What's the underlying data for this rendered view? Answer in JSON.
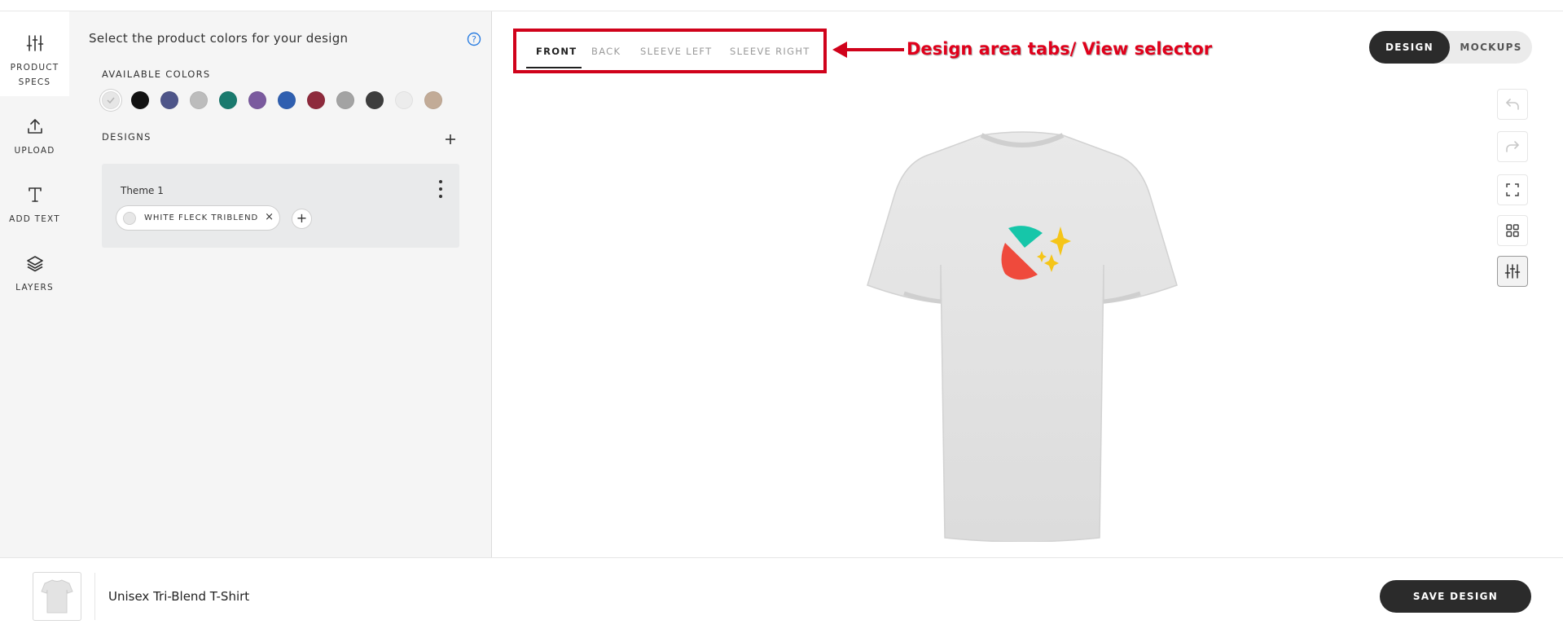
{
  "rail": {
    "items": [
      {
        "label_line1": "PRODUCT",
        "label_line2": "SPECS",
        "icon": "sliders-icon"
      },
      {
        "label": "UPLOAD",
        "icon": "upload-icon"
      },
      {
        "label": "ADD TEXT",
        "icon": "text-icon"
      },
      {
        "label": "LAYERS",
        "icon": "layers-icon"
      }
    ]
  },
  "panel": {
    "title": "Select the product colors for your design",
    "help_icon": "question-circle-icon",
    "available_colors_label": "AVAILABLE COLORS",
    "colors": [
      "#e6e6e6",
      "#111111",
      "#4e5589",
      "#bcbcbc",
      "#1a7a6e",
      "#7a5a9e",
      "#2f5fb0",
      "#8e2a3c",
      "#a3a3a3",
      "#3d3d3d",
      "#ececec",
      "#c2ab97"
    ],
    "designs_label": "DESIGNS",
    "add_icon": "plus-icon",
    "theme": {
      "name": "Theme 1",
      "chip_label": "WHITE FLECK TRIBLEND",
      "chip_close": "×",
      "chip_add": "+"
    }
  },
  "canvas": {
    "tabs": [
      "FRONT",
      "BACK",
      "SLEEVE LEFT",
      "SLEEVE RIGHT"
    ],
    "active_tab": "FRONT",
    "annotation": "Design area tabs/ View selector",
    "annotation_color": "#e0001b",
    "toggle": {
      "design": "DESIGN",
      "mockups": "MOCKUPS"
    },
    "tools": [
      "undo-icon",
      "redo-icon",
      "fullscreen-icon",
      "grid-icon",
      "adjust-icon"
    ]
  },
  "footer": {
    "product_name": "Unisex Tri-Blend T-Shirt",
    "save_label": "SAVE DESIGN"
  }
}
